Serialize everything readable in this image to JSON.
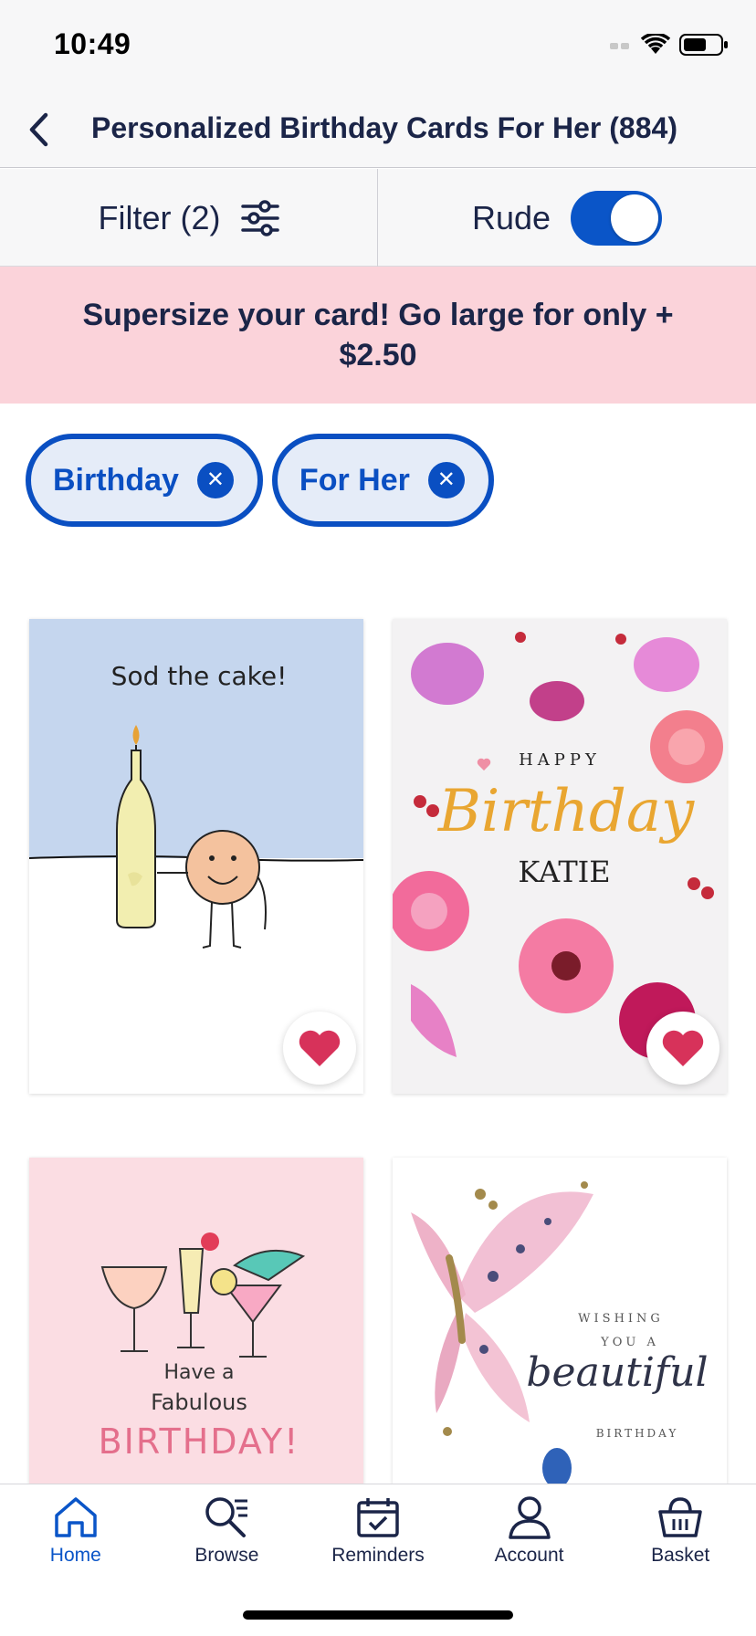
{
  "status_bar": {
    "time": "10:49"
  },
  "header": {
    "title": "Personalized Birthday Cards For Her (884)"
  },
  "filters": {
    "filter_label": "Filter (2)",
    "toggle_label": "Rude",
    "toggle_on": true
  },
  "promo": {
    "text": "Supersize your card! Go large for only + $2.50"
  },
  "chips": [
    {
      "label": "Birthday"
    },
    {
      "label": "For Her"
    }
  ],
  "cards": [
    {
      "text": "Sod the cake!",
      "favorited": true
    },
    {
      "text_top": "HAPPY",
      "text_script": "Birthday",
      "text_name": "KATIE",
      "favorited": true
    },
    {
      "text_lines": [
        "Have a",
        "Fabulous",
        "BIRTHDAY!"
      ]
    },
    {
      "text_lines": [
        "WISHING",
        "YOU A",
        "beautiful",
        "BIRTHDAY"
      ]
    }
  ],
  "nav": {
    "items": [
      {
        "label": "Home",
        "icon": "home-icon",
        "active": true
      },
      {
        "label": "Browse",
        "icon": "browse-icon",
        "active": false
      },
      {
        "label": "Reminders",
        "icon": "calendar-icon",
        "active": false
      },
      {
        "label": "Account",
        "icon": "account-icon",
        "active": false
      },
      {
        "label": "Basket",
        "icon": "basket-icon",
        "active": false
      }
    ]
  },
  "colors": {
    "accent": "#0a55c8",
    "navy": "#1b2548",
    "promo_bg": "#fbd3da",
    "heart": "#d7325a"
  }
}
